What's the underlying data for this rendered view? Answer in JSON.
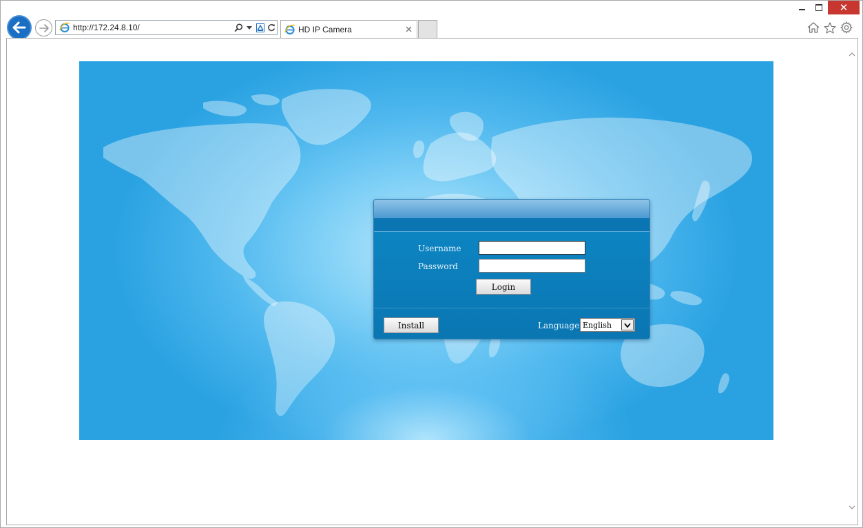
{
  "browser": {
    "address_url": "http://172.24.8.10/",
    "tab_title": "HD IP Camera",
    "icons": {
      "back": "back-arrow-icon",
      "forward": "forward-arrow-icon",
      "search": "search-icon",
      "compat": "compatibility-view-icon",
      "refresh": "refresh-icon",
      "home": "home-icon",
      "favorites": "star-icon",
      "tools": "gear-icon"
    },
    "window_close": "✕"
  },
  "login": {
    "username_label": "Username",
    "password_label": "Password",
    "username_value": "",
    "password_value": "",
    "login_button": "Login",
    "install_button": "Install",
    "language_label": "Language",
    "language_selected": "English"
  },
  "colors": {
    "accent": "#1a6fc4",
    "panel": "#0a76b2",
    "close": "#c7372f"
  }
}
